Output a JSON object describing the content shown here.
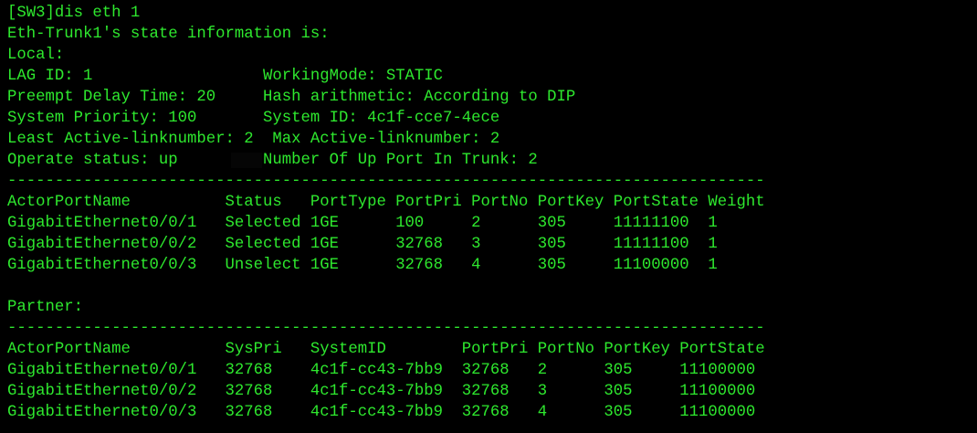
{
  "terminal": {
    "text_color": "#2ee82e",
    "background_color": "#000000",
    "lines": [
      "[SW3]dis eth 1",
      "Eth-Trunk1's state information is:",
      "Local:",
      "LAG ID: 1                  WorkingMode: STATIC",
      "Preempt Delay Time: 20     Hash arithmetic: According to DIP",
      "System Priority: 100       System ID: 4c1f-cce7-4ece",
      "Least Active-linknumber: 2  Max Active-linknumber: 2",
      "Operate status: up         Number Of Up Port In Trunk: 2",
      "--------------------------------------------------------------------------------",
      "ActorPortName          Status   PortType PortPri PortNo PortKey PortState Weight",
      "GigabitEthernet0/0/1   Selected 1GE      100     2      305     11111100  1",
      "GigabitEthernet0/0/2   Selected 1GE      32768   3      305     11111100  1",
      "GigabitEthernet0/0/3   Unselect 1GE      32768   4      305     11100000  1",
      "",
      "Partner:",
      "--------------------------------------------------------------------------------",
      "ActorPortName          SysPri   SystemID        PortPri PortNo PortKey PortState",
      "GigabitEthernet0/0/1   32768    4c1f-cc43-7bb9  32768   2      305     11100000",
      "GigabitEthernet0/0/2   32768    4c1f-cc43-7bb9  32768   3      305     11100000",
      "GigabitEthernet0/0/3   32768    4c1f-cc43-7bb9  32768   4      305     11100000"
    ]
  }
}
